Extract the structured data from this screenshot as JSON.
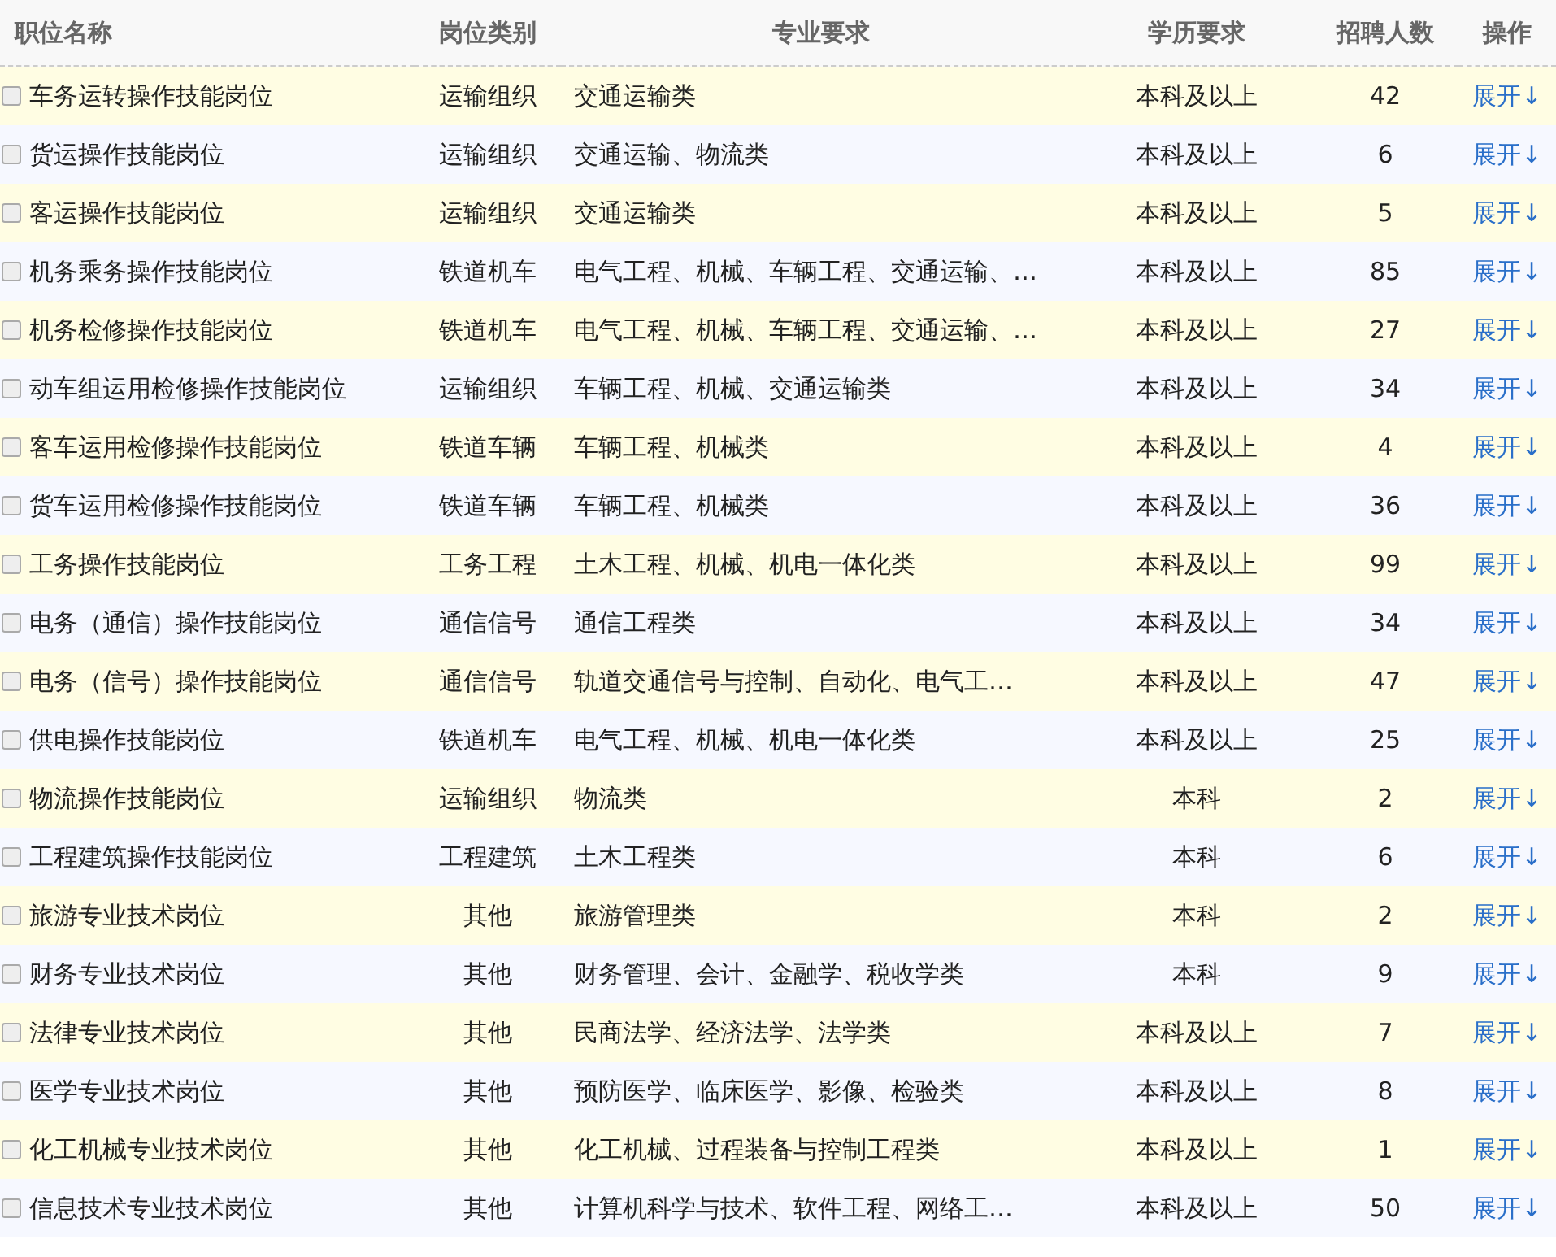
{
  "table": {
    "columns": [
      "职位名称",
      "岗位类别",
      "专业要求",
      "学历要求",
      "招聘人数",
      "操作"
    ],
    "rows": [
      {
        "checked": false,
        "name": "车务运转操作技能岗位",
        "category": "运输组织",
        "major": "交通运输类",
        "education": "本科及以上",
        "count": "42",
        "action": "展开↓"
      },
      {
        "checked": false,
        "name": "货运操作技能岗位",
        "category": "运输组织",
        "major": "交通运输、物流类",
        "education": "本科及以上",
        "count": "6",
        "action": "展开↓"
      },
      {
        "checked": false,
        "name": "客运操作技能岗位",
        "category": "运输组织",
        "major": "交通运输类",
        "education": "本科及以上",
        "count": "5",
        "action": "展开↓"
      },
      {
        "checked": false,
        "name": "机务乘务操作技能岗位",
        "category": "铁道机车",
        "major": "电气工程、机械、车辆工程、交通运输、…",
        "education": "本科及以上",
        "count": "85",
        "action": "展开↓"
      },
      {
        "checked": false,
        "name": "机务检修操作技能岗位",
        "category": "铁道机车",
        "major": "电气工程、机械、车辆工程、交通运输、…",
        "education": "本科及以上",
        "count": "27",
        "action": "展开↓"
      },
      {
        "checked": false,
        "name": "动车组运用检修操作技能岗位",
        "category": "运输组织",
        "major": "车辆工程、机械、交通运输类",
        "education": "本科及以上",
        "count": "34",
        "action": "展开↓"
      },
      {
        "checked": false,
        "name": "客车运用检修操作技能岗位",
        "category": "铁道车辆",
        "major": "车辆工程、机械类",
        "education": "本科及以上",
        "count": "4",
        "action": "展开↓"
      },
      {
        "checked": false,
        "name": "货车运用检修操作技能岗位",
        "category": "铁道车辆",
        "major": "车辆工程、机械类",
        "education": "本科及以上",
        "count": "36",
        "action": "展开↓"
      },
      {
        "checked": false,
        "name": "工务操作技能岗位",
        "category": "工务工程",
        "major": "土木工程、机械、机电一体化类",
        "education": "本科及以上",
        "count": "99",
        "action": "展开↓"
      },
      {
        "checked": false,
        "name": "电务（通信）操作技能岗位",
        "category": "通信信号",
        "major": "通信工程类",
        "education": "本科及以上",
        "count": "34",
        "action": "展开↓"
      },
      {
        "checked": false,
        "name": "电务（信号）操作技能岗位",
        "category": "通信信号",
        "major": "轨道交通信号与控制、自动化、电气工…",
        "education": "本科及以上",
        "count": "47",
        "action": "展开↓"
      },
      {
        "checked": false,
        "name": "供电操作技能岗位",
        "category": "铁道机车",
        "major": "电气工程、机械、机电一体化类",
        "education": "本科及以上",
        "count": "25",
        "action": "展开↓"
      },
      {
        "checked": false,
        "name": "物流操作技能岗位",
        "category": "运输组织",
        "major": "物流类",
        "education": "本科",
        "count": "2",
        "action": "展开↓"
      },
      {
        "checked": false,
        "name": "工程建筑操作技能岗位",
        "category": "工程建筑",
        "major": "土木工程类",
        "education": "本科",
        "count": "6",
        "action": "展开↓"
      },
      {
        "checked": false,
        "name": "旅游专业技术岗位",
        "category": "其他",
        "major": "旅游管理类",
        "education": "本科",
        "count": "2",
        "action": "展开↓"
      },
      {
        "checked": false,
        "name": "财务专业技术岗位",
        "category": "其他",
        "major": "财务管理、会计、金融学、税收学类",
        "education": "本科",
        "count": "9",
        "action": "展开↓"
      },
      {
        "checked": false,
        "name": "法律专业技术岗位",
        "category": "其他",
        "major": "民商法学、经济法学、法学类",
        "education": "本科及以上",
        "count": "7",
        "action": "展开↓"
      },
      {
        "checked": false,
        "name": "医学专业技术岗位",
        "category": "其他",
        "major": "预防医学、临床医学、影像、检验类",
        "education": "本科及以上",
        "count": "8",
        "action": "展开↓"
      },
      {
        "checked": false,
        "name": "化工机械专业技术岗位",
        "category": "其他",
        "major": "化工机械、过程装备与控制工程类",
        "education": "本科及以上",
        "count": "1",
        "action": "展开↓"
      },
      {
        "checked": false,
        "name": "信息技术专业技术岗位",
        "category": "其他",
        "major": "计算机科学与技术、软件工程、网络工…",
        "education": "本科及以上",
        "count": "50",
        "action": "展开↓"
      }
    ]
  }
}
